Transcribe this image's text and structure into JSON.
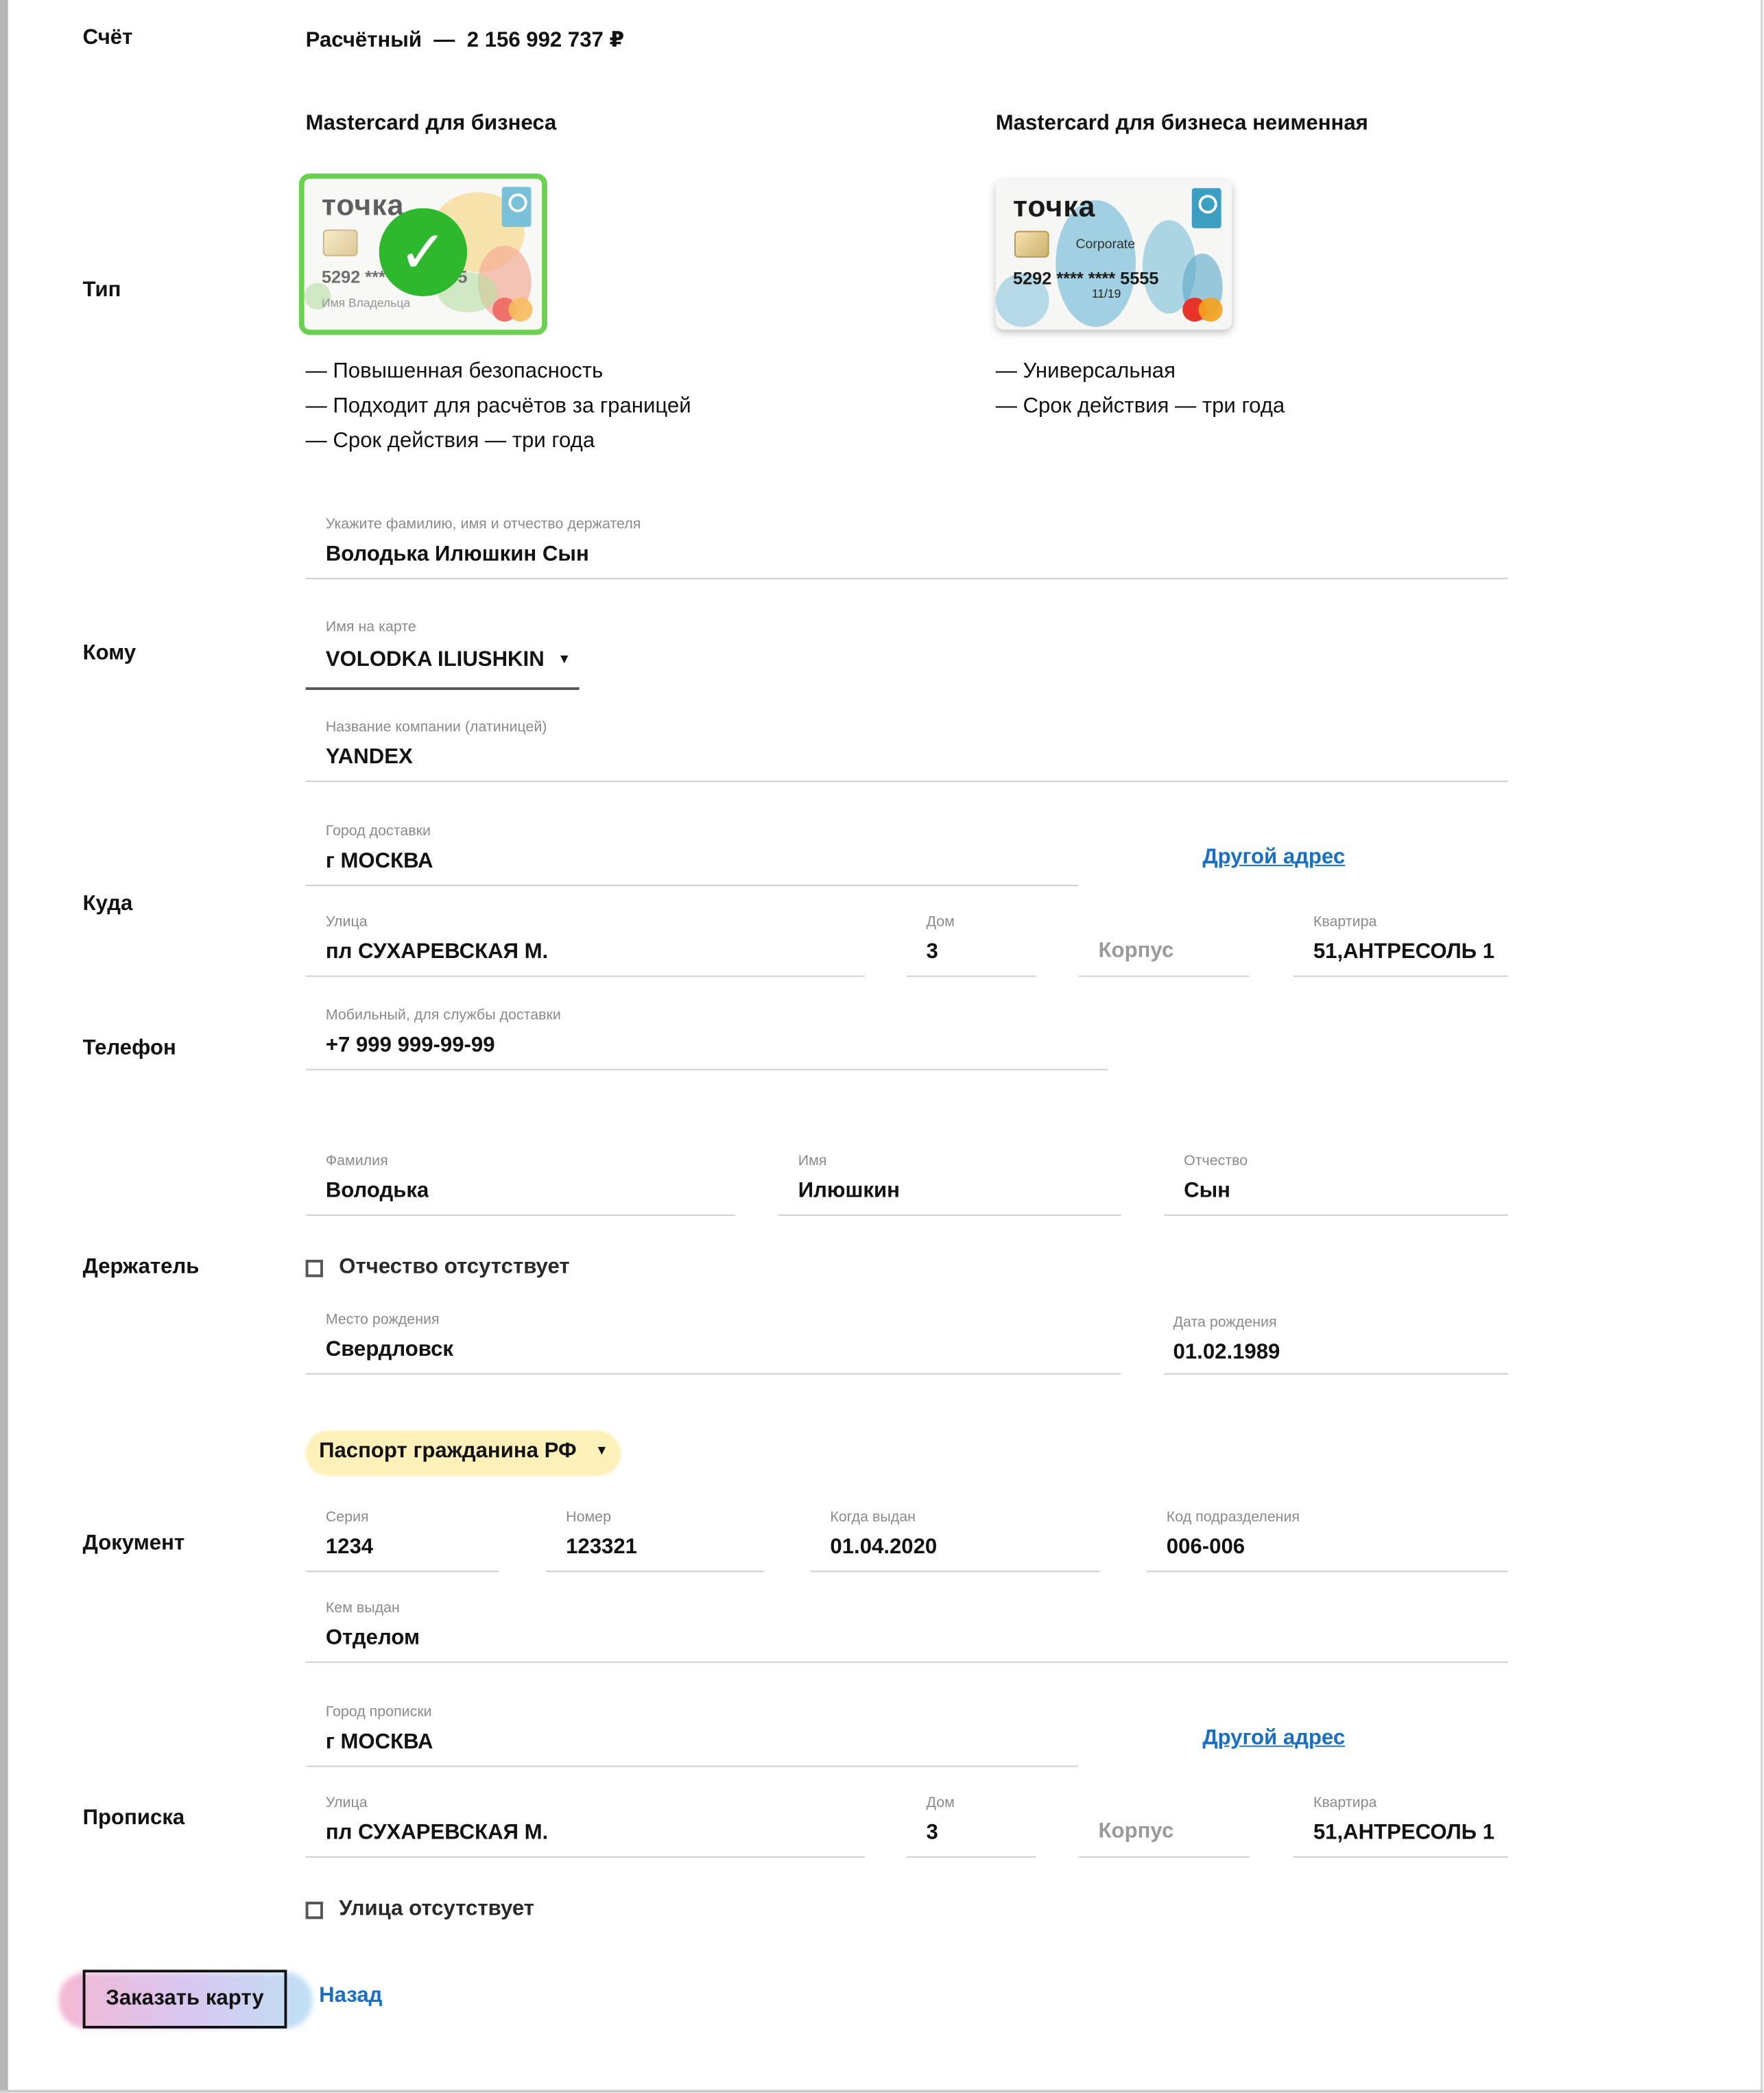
{
  "account": {
    "label": "Счёт",
    "value": "Расчётный  —  2 156 992 737 ₽"
  },
  "type": {
    "label": "Тип",
    "cards": [
      {
        "title": "Mastercard для бизнеса",
        "brand": "точка",
        "number": "5292 **** **** 5555",
        "owner": "Имя Владельца",
        "selected": true,
        "features": [
          "— Повышенная безопасность",
          "— Подходит для расчётов за границей",
          "— Срок действия — три года"
        ]
      },
      {
        "title": "Mastercard для бизнеса неименная",
        "brand": "точка",
        "subtitle": "Corporate",
        "number": "5292 **** **** 5555",
        "expiry": "11/19",
        "selected": false,
        "features": [
          "— Универсальная",
          "— Срок действия — три года"
        ]
      }
    ]
  },
  "recipient": {
    "label": "Кому",
    "holder_name": {
      "caption": "Укажите фамилию, имя и отчество держателя",
      "value": "Володька Илюшкин Сын"
    },
    "card_name": {
      "caption": "Имя на карте",
      "value": "VOLODKA ILIUSHKIN"
    },
    "company": {
      "caption": "Название компании (латиницей)",
      "value": "YANDEX"
    }
  },
  "delivery": {
    "label": "Куда",
    "city": {
      "caption": "Город доставки",
      "value": "г МОСКВА"
    },
    "other_address": "Другой адрес",
    "street": {
      "caption": "Улица",
      "value": "пл СУХАРЕВСКАЯ М."
    },
    "house": {
      "caption": "Дом",
      "value": "3"
    },
    "building": {
      "placeholder": "Корпус"
    },
    "apartment": {
      "caption": "Квартира",
      "value": "51,АНТРЕСОЛЬ 1"
    }
  },
  "phone": {
    "label": "Телефон",
    "caption": "Мобильный, для службы доставки",
    "value": "+7 999 999-99-99"
  },
  "holder": {
    "label": "Держатель",
    "last_name": {
      "caption": "Фамилия",
      "value": "Володька"
    },
    "first_name": {
      "caption": "Имя",
      "value": "Илюшкин"
    },
    "patronymic": {
      "caption": "Отчество",
      "value": "Сын"
    },
    "no_patronymic": "Отчество отсутствует",
    "birthplace": {
      "caption": "Место рождения",
      "value": "Свердловск"
    },
    "birthdate": {
      "caption": "Дата рождения",
      "value": "01.02.1989"
    }
  },
  "document": {
    "label": "Документ",
    "type": "Паспорт гражданина РФ",
    "series": {
      "caption": "Серия",
      "value": "1234"
    },
    "number": {
      "caption": "Номер",
      "value": "123321"
    },
    "issued_on": {
      "caption": "Когда выдан",
      "value": "01.04.2020"
    },
    "division_code": {
      "caption": "Код подразделения",
      "value": "006-006"
    },
    "issued_by": {
      "caption": "Кем выдан",
      "value": "Отделом"
    }
  },
  "registration": {
    "label": "Прописка",
    "city": {
      "caption": "Город прописки",
      "value": "г МОСКВА"
    },
    "other_address": "Другой адрес",
    "street": {
      "caption": "Улица",
      "value": "пл СУХАРЕВСКАЯ М."
    },
    "house": {
      "caption": "Дом",
      "value": "3"
    },
    "building": {
      "placeholder": "Корпус"
    },
    "apartment": {
      "caption": "Квартира",
      "value": "51,АНТРЕСОЛЬ 1"
    },
    "no_street": "Улица отсутствует"
  },
  "actions": {
    "order": "Заказать карту",
    "back": "Назад"
  },
  "colors": {
    "link": "#1b6fc2",
    "selected_border": "#6ad150",
    "check": "#2eb82e"
  }
}
